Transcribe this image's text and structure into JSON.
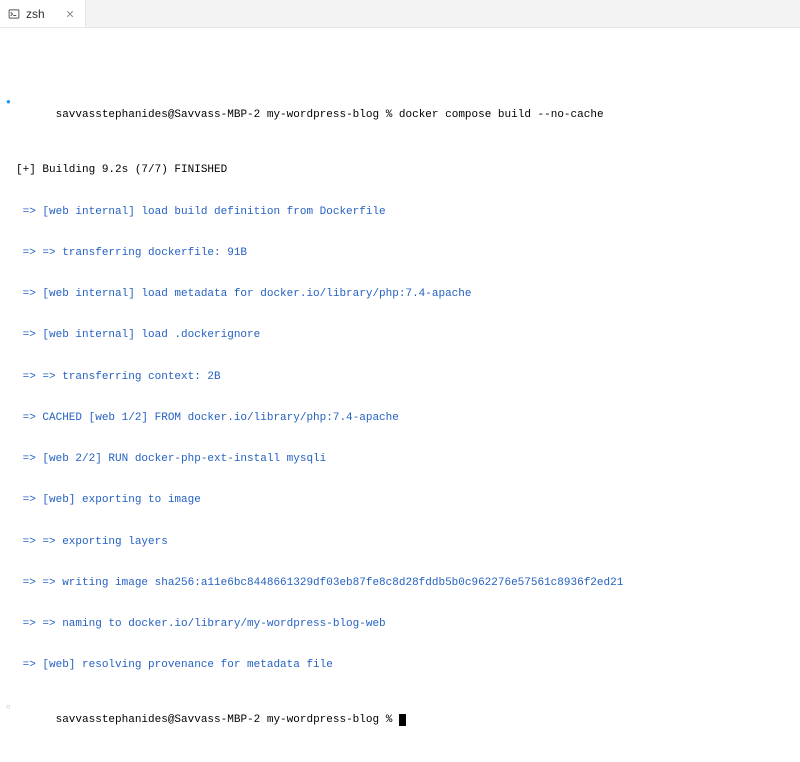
{
  "tab": {
    "label": "zsh"
  },
  "terminal": {
    "prompt1": {
      "user_host": "savvasstephanides@Savvass-MBP-2",
      "path": "my-wordpress-blog",
      "symbol": "%",
      "command": "docker compose build --no-cache"
    },
    "build_header": "[+] Building 9.2s (7/7) FINISHED",
    "lines": [
      " => [web internal] load build definition from Dockerfile",
      " => => transferring dockerfile: 91B",
      " => [web internal] load metadata for docker.io/library/php:7.4-apache",
      " => [web internal] load .dockerignore",
      " => => transferring context: 2B",
      " => CACHED [web 1/2] FROM docker.io/library/php:7.4-apache",
      " => [web 2/2] RUN docker-php-ext-install mysqli",
      " => [web] exporting to image",
      " => => exporting layers",
      " => => writing image sha256:a11e6bc8448661329df03eb87fe8c8d28fddb5b0c962276e57561c8936f2ed21",
      " => => naming to docker.io/library/my-wordpress-blog-web",
      " => [web] resolving provenance for metadata file"
    ],
    "prompt2": {
      "user_host": "savvasstephanides@Savvass-MBP-2",
      "path": "my-wordpress-blog",
      "symbol": "%"
    }
  }
}
